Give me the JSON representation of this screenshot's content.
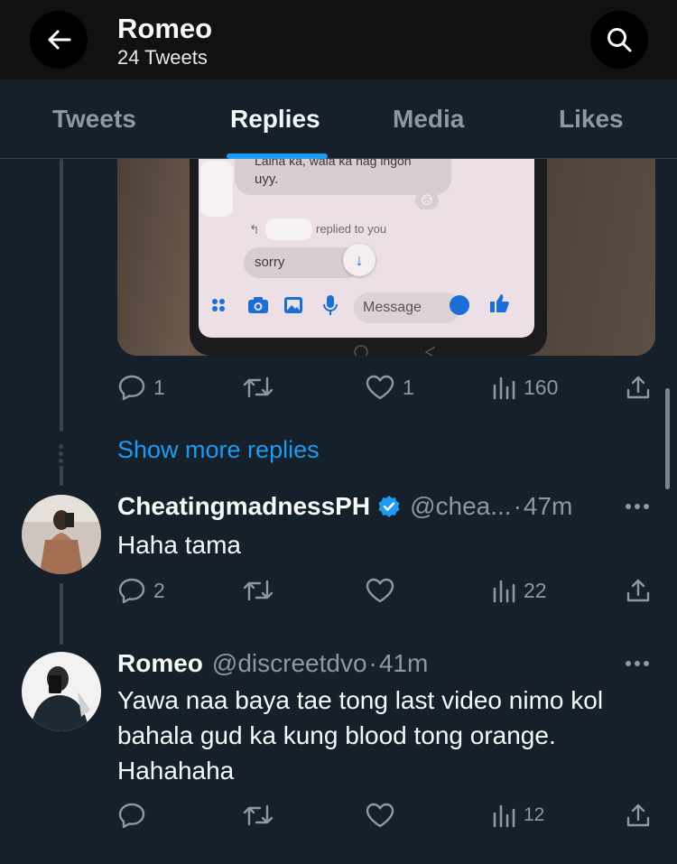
{
  "header": {
    "name": "Romeo",
    "tweet_count": "24 Tweets"
  },
  "tabs": [
    {
      "label": "Tweets",
      "active": false
    },
    {
      "label": "Replies",
      "active": true
    },
    {
      "label": "Media",
      "active": false
    },
    {
      "label": "Likes",
      "active": false
    }
  ],
  "media": {
    "visible_text": {
      "line1": "Laina ka, wala ka nag ingon",
      "line2": "uyy.",
      "reply_label": "replied to you",
      "message": "sorry",
      "input_placeholder": "Message"
    }
  },
  "tweet0": {
    "replies": "1",
    "likes": "1",
    "views": "160"
  },
  "show_more": "Show more replies",
  "tweet1": {
    "name": "CheatingmadnessPH",
    "handle": "@chea...",
    "time": "47m",
    "text": "Haha tama",
    "replies": "2",
    "views": "22"
  },
  "tweet2": {
    "name": "Romeo",
    "handle": "@discreetdvo",
    "time": "41m",
    "text_lines": [
      "Yawa naa baya tae tong last video nimo kol",
      "bahala gud ka kung blood tong orange.",
      "Hahahaha"
    ],
    "views": "12"
  },
  "colors": {
    "background": "#15202b",
    "accent": "#1d9bf0",
    "muted": "#8b98a5"
  }
}
